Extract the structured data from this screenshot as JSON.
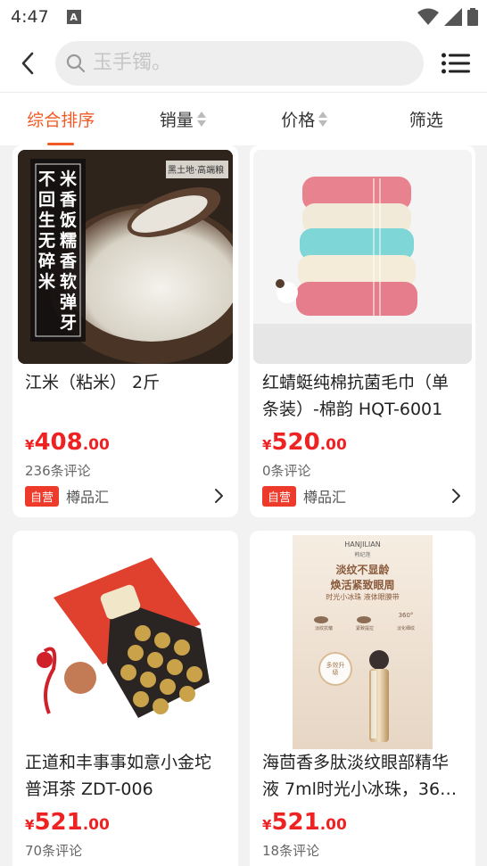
{
  "status": {
    "time": "4:47",
    "a_badge": "A"
  },
  "search": {
    "placeholder": "玉手镯。"
  },
  "sort": {
    "tabs": [
      {
        "label": "综合排序"
      },
      {
        "label": "销量"
      },
      {
        "label": "价格"
      },
      {
        "label": "筛选"
      }
    ]
  },
  "products": [
    {
      "title": "江米（粘米） 2斤",
      "currency": "¥",
      "price_int": "408",
      "price_dec": ".00",
      "reviews": "236条评论",
      "badge": "自营",
      "shop": "樽品汇",
      "image_text": {
        "left": "不回生 无碎米",
        "right": "米香饭糯 香软弹牙",
        "tag": "黑土地·高端粮"
      }
    },
    {
      "title": "红蜻蜓纯棉抗菌毛巾（单条装）-棉韵 HQT-6001",
      "currency": "¥",
      "price_int": "520",
      "price_dec": ".00",
      "reviews": "0条评论",
      "badge": "自营",
      "shop": "樽品汇"
    },
    {
      "title": "正道和丰事事如意小金坨普洱茶 ZDT-006",
      "currency": "¥",
      "price_int": "521",
      "price_dec": ".00",
      "reviews": "70条评论"
    },
    {
      "title": "海茴香多肽淡纹眼部精华液 7ml时光小冰珠，36…",
      "currency": "¥",
      "price_int": "521",
      "price_dec": ".00",
      "reviews": "18条评论",
      "image_text": {
        "brand": "HANJILIAN",
        "brand_sub": "韩纪莲",
        "line1": "淡纹不显龄",
        "line2": "焕活紧致眼周",
        "line3": "时光小冰珠 液体眼膜带",
        "badge": "多效升级",
        "f1": "淡纹抗皱",
        "f2": "紧致提拉",
        "f3": "淡化细纹",
        "f4": "360°"
      }
    }
  ],
  "colors": {
    "accent": "#f25a25",
    "price": "#ee2222",
    "badge": "#ee3a2a"
  }
}
